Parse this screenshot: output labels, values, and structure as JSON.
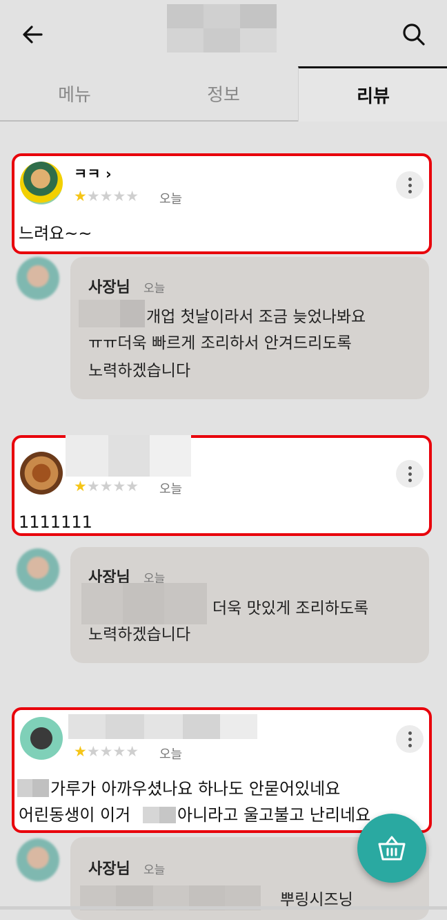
{
  "header": {
    "back_icon": "arrow-left-icon",
    "search_icon": "search-icon"
  },
  "tabs": [
    {
      "label": "메뉴",
      "active": false
    },
    {
      "label": "정보",
      "active": false
    },
    {
      "label": "리뷰",
      "active": true
    }
  ],
  "reviews": [
    {
      "nickname": "ㅋㅋ ›",
      "rating": 1,
      "max_rating": 5,
      "date": "오늘",
      "text_lines": [
        "느려요~~"
      ],
      "reply": {
        "name": "사장님",
        "date": "오늘",
        "text_lines": [
          "개업 첫날이라서 조금 늦었나봐요",
          "ㅠㅠ더욱 빠르게 조리하서 안겨드리도록",
          "노력하겠습니다"
        ]
      }
    },
    {
      "nickname": "",
      "rating": 1,
      "max_rating": 5,
      "date": "오늘",
      "text_lines": [
        "1111111"
      ],
      "reply": {
        "name": "사장님",
        "date": "오늘",
        "text_lines": [
          "더욱 맛있게 조리하도록",
          "노력하겠습니다"
        ]
      }
    },
    {
      "nickname": "",
      "rating": 1,
      "max_rating": 5,
      "date": "오늘",
      "text_lines": [
        "가루가 아까우셨나요 하나도 안묻어있네요",
        "어린동생이 이거",
        "아니라고 울고불고 난리네요"
      ],
      "reply": {
        "name": "사장님",
        "date": "오늘",
        "text_lines": [
          "뿌링시즈닝"
        ]
      }
    }
  ],
  "colors": {
    "highlight_border": "#e8000b",
    "star": "#f5c518",
    "fab": "#2aa9a1"
  },
  "fab_icon": "shopping-basket-icon"
}
